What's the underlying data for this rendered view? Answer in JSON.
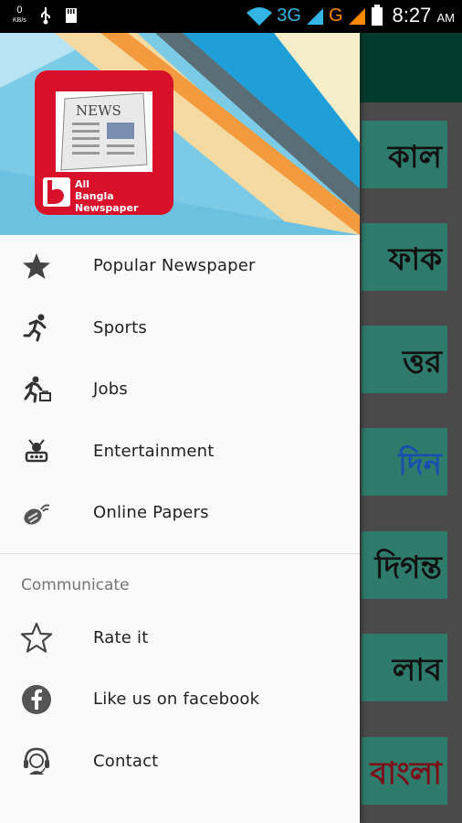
{
  "status_bar": {
    "speed_value": "0",
    "speed_unit": "KB/s",
    "network_3g": "3G",
    "network_g": "G",
    "time": "8:27",
    "ampm": "AM"
  },
  "drawer": {
    "logo": {
      "paper_text": "NEWS",
      "line1": "All",
      "line2": "Bangla Newspaper"
    },
    "menu_items": [
      {
        "label": "Popular Newspaper",
        "icon": "star-icon"
      },
      {
        "label": "Sports",
        "icon": "running-icon"
      },
      {
        "label": "Jobs",
        "icon": "job-runner-icon"
      },
      {
        "label": "Entertainment",
        "icon": "entertainment-icon"
      },
      {
        "label": "Online Papers",
        "icon": "online-icon"
      }
    ],
    "communicate_header": "Communicate",
    "communicate_items": [
      {
        "label": "Rate it",
        "icon": "star-outline-icon"
      },
      {
        "label": "Like us on facebook",
        "icon": "facebook-icon"
      },
      {
        "label": "Contact",
        "icon": "headset-icon"
      }
    ]
  },
  "background_cards": [
    {
      "text": "কাল"
    },
    {
      "text": "ফাক"
    },
    {
      "text": "ত্তর"
    },
    {
      "text": "দিন"
    },
    {
      "text": "দিগন্ত"
    },
    {
      "text": "লাব"
    },
    {
      "text": "বাংলা"
    }
  ],
  "colors": {
    "status_3g": "#33b5e5",
    "status_g": "#ff8800",
    "logo_red": "#d8102a",
    "header_blue": "#8fd3ea",
    "toolbar": "#003b2e"
  }
}
